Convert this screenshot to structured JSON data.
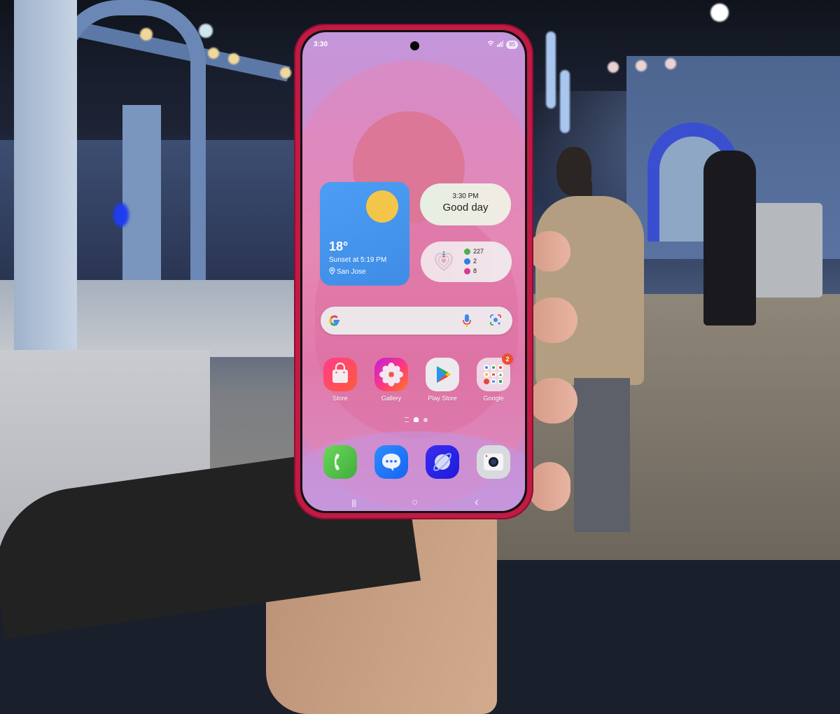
{
  "status_bar": {
    "time": "3:30",
    "battery": "95",
    "wifi_icon": "wifi-icon",
    "signal_icon": "signal-icon"
  },
  "widgets": {
    "weather": {
      "temperature": "18°",
      "sunset": "Sunset at 5:19 PM",
      "location": "San Jose",
      "condition_icon": "sun-icon",
      "background": "#4b9ef3"
    },
    "clock": {
      "time": "3:30 PM",
      "greeting": "Good day"
    },
    "health": {
      "stats": [
        {
          "icon": "steps-icon",
          "value": "227",
          "color": "#4caf50"
        },
        {
          "icon": "active-time-icon",
          "value": "2",
          "color": "#2f7fe0"
        },
        {
          "icon": "calories-icon",
          "value": "8",
          "color": "#d63b8f"
        }
      ]
    }
  },
  "search_bar": {
    "logo_icon": "google-g-icon",
    "mic_icon": "mic-icon",
    "lens_icon": "google-lens-icon"
  },
  "apps": [
    {
      "label": "Store",
      "icon": "shopping-bag-icon"
    },
    {
      "label": "Gallery",
      "icon": "flower-icon"
    },
    {
      "label": "Play Store",
      "icon": "play-store-icon"
    },
    {
      "label": "Google",
      "icon": "folder-icon",
      "badge": "2"
    }
  ],
  "dock": [
    {
      "name": "Phone",
      "icon": "phone-icon"
    },
    {
      "name": "Messages",
      "icon": "message-icon"
    },
    {
      "name": "Internet",
      "icon": "browser-icon"
    },
    {
      "name": "Camera",
      "icon": "camera-icon"
    }
  ],
  "pager": {
    "pages": 2,
    "current": 1
  },
  "navigation": {
    "recents": "|||",
    "home": "○",
    "back": "‹"
  },
  "colors": {
    "phone_frame": "#c01a45",
    "wallpaper_top": "#c496dc",
    "wallpaper_mid": "#e18cb8"
  }
}
